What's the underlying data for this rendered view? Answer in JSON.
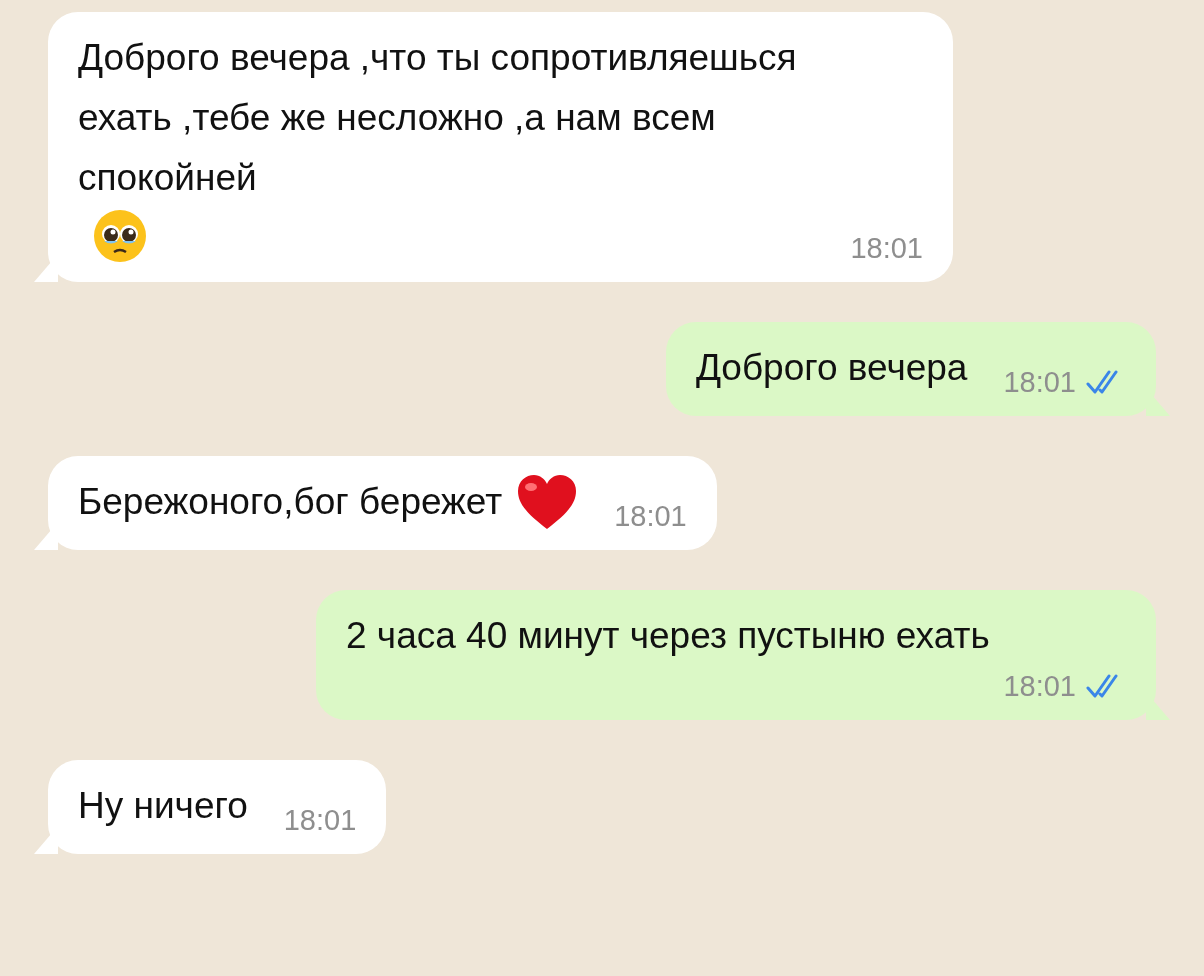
{
  "messages": [
    {
      "kind": "incoming",
      "text": "Доброго вечера ,что ты сопротивляешься ехать ,тебе же несложно ,а нам всем спокойней",
      "emoji": {
        "kind": "pleading"
      },
      "time": "18:01"
    },
    {
      "kind": "outgoing",
      "text": "Доброго вечера",
      "time": "18:01",
      "read": true
    },
    {
      "kind": "incoming",
      "text": "Бережоного,бог бережет",
      "emoji": {
        "kind": "heart"
      },
      "time": "18:01"
    },
    {
      "kind": "outgoing",
      "text": "2 часа 40 минут через пустыню ехать",
      "time": "18:01",
      "read": true
    },
    {
      "kind": "incoming",
      "text": "Ну ничего",
      "time": "18:01"
    }
  ]
}
